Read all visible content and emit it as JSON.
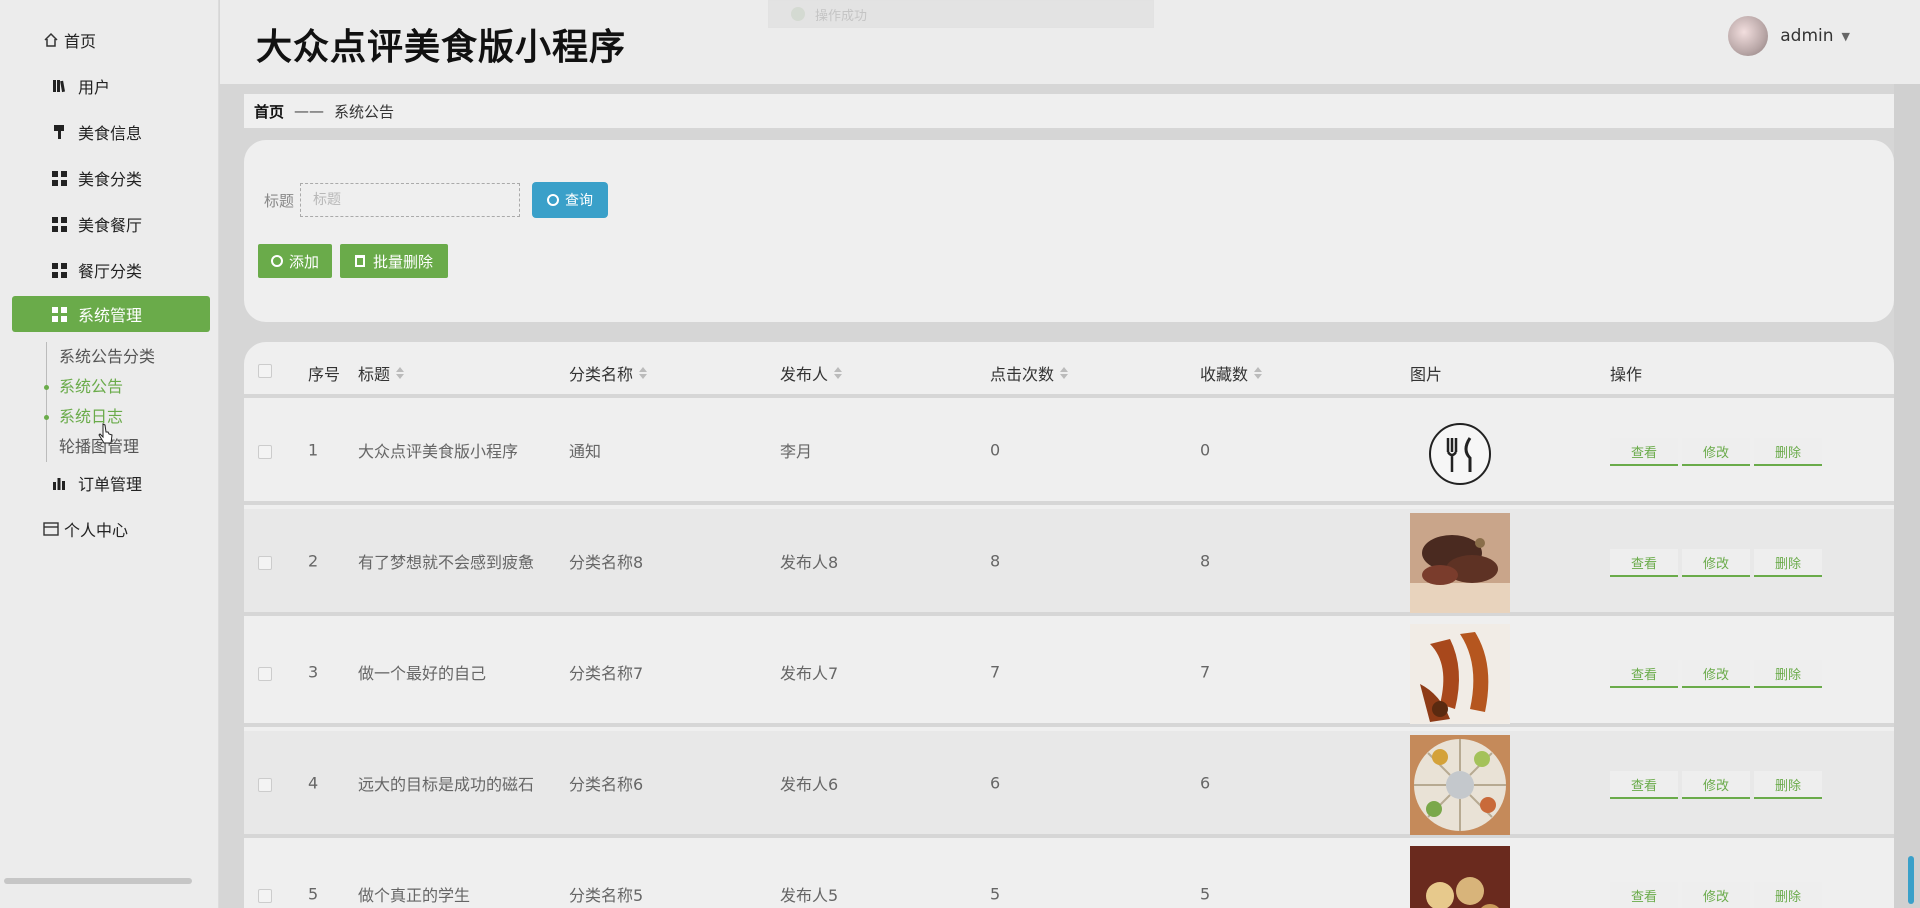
{
  "app": {
    "title": "大众点评美食版小程序"
  },
  "toast": {
    "text": "操作成功"
  },
  "user": {
    "name": "admin"
  },
  "sidebar": {
    "items": [
      {
        "label": "首页",
        "icon": "home-icon"
      },
      {
        "label": "用户",
        "icon": "book-icon"
      },
      {
        "label": "美食信息",
        "icon": "brush-icon"
      },
      {
        "label": "美食分类",
        "icon": "grid-icon"
      },
      {
        "label": "美食餐厅",
        "icon": "grid-icon"
      },
      {
        "label": "餐厅分类",
        "icon": "grid-icon"
      },
      {
        "label": "系统管理",
        "icon": "grid-icon",
        "active": true
      },
      {
        "label": "订单管理",
        "icon": "bar-chart-icon"
      },
      {
        "label": "个人中心",
        "icon": "card-icon"
      }
    ],
    "subitems": [
      {
        "label": "系统公告分类"
      },
      {
        "label": "系统公告"
      },
      {
        "label": "系统日志"
      },
      {
        "label": "轮播图管理"
      }
    ]
  },
  "breadcrumb": {
    "home": "首页",
    "sep": "——",
    "current": "系统公告"
  },
  "search": {
    "label": "标题",
    "placeholder": "标题",
    "query_label": "查询"
  },
  "actions": {
    "add_label": "添加",
    "batch_delete_label": "批量删除"
  },
  "table": {
    "headers": {
      "index": "序号",
      "title": "标题",
      "category": "分类名称",
      "publisher": "发布人",
      "clicks": "点击次数",
      "favorites": "收藏数",
      "image": "图片",
      "operation": "操作"
    },
    "op_labels": {
      "view": "查看",
      "edit": "修改",
      "delete": "删除"
    },
    "rows": [
      {
        "index": "1",
        "title": "大众点评美食版小程序",
        "category": "通知",
        "publisher": "李月",
        "clicks": "0",
        "favorites": "0",
        "image": "utensils-logo"
      },
      {
        "index": "2",
        "title": "有了梦想就不会感到疲惫",
        "category": "分类名称8",
        "publisher": "发布人8",
        "clicks": "8",
        "favorites": "8",
        "image": "steak-photo"
      },
      {
        "index": "3",
        "title": "做一个最好的自己",
        "category": "分类名称7",
        "publisher": "发布人7",
        "clicks": "7",
        "favorites": "7",
        "image": "chicken-feet-photo"
      },
      {
        "index": "4",
        "title": "远大的目标是成功的磁石",
        "category": "分类名称6",
        "publisher": "发布人6",
        "clicks": "6",
        "favorites": "6",
        "image": "platter-photo"
      },
      {
        "index": "5",
        "title": "做个真正的学生",
        "category": "分类名称5",
        "publisher": "发布人5",
        "clicks": "5",
        "favorites": "5",
        "image": "dishes-photo"
      }
    ]
  },
  "colors": {
    "accent": "#6aab4a",
    "query": "#3aa0c9"
  }
}
